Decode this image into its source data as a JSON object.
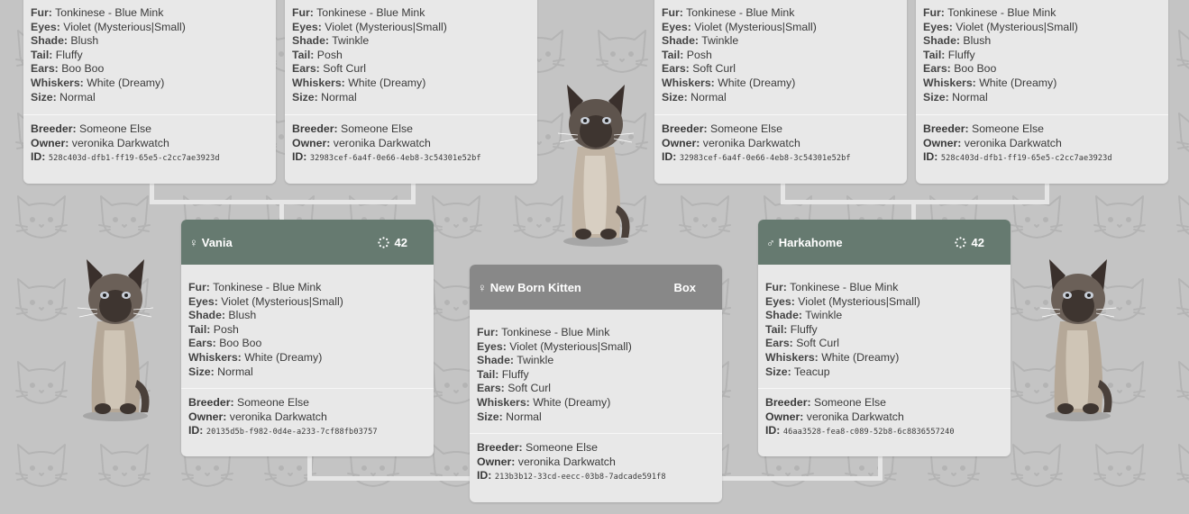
{
  "colors": {
    "female_header": "#667a70",
    "male_header": "#667a70",
    "kitten_header": "#888888",
    "background": "#c4c4c4",
    "card": "#e8e8e8"
  },
  "labels": {
    "fur": "Fur:",
    "eyes": "Eyes:",
    "shade": "Shade:",
    "tail": "Tail:",
    "ears": "Ears:",
    "whiskers": "Whiskers:",
    "size": "Size:",
    "breeder": "Breeder:",
    "owner": "Owner:",
    "id": "ID:"
  },
  "grandparents": [
    {
      "fur": "Tonkinese - Blue Mink",
      "eyes": "Violet (Mysterious|Small)",
      "shade": "Blush",
      "tail": "Fluffy",
      "ears": "Boo Boo",
      "whiskers": "White (Dreamy)",
      "size": "Normal",
      "breeder": "Someone Else",
      "owner": "veronika Darkwatch",
      "id": "528c403d-dfb1-ff19-65e5-c2cc7ae3923d"
    },
    {
      "fur": "Tonkinese - Blue Mink",
      "eyes": "Violet (Mysterious|Small)",
      "shade": "Twinkle",
      "tail": "Posh",
      "ears": "Soft Curl",
      "whiskers": "White (Dreamy)",
      "size": "Normal",
      "breeder": "Someone Else",
      "owner": "veronika Darkwatch",
      "id": "32983cef-6a4f-0e66-4eb8-3c54301e52bf"
    },
    {
      "fur": "Tonkinese - Blue Mink",
      "eyes": "Violet (Mysterious|Small)",
      "shade": "Twinkle",
      "tail": "Posh",
      "ears": "Soft Curl",
      "whiskers": "White (Dreamy)",
      "size": "Normal",
      "breeder": "Someone Else",
      "owner": "veronika Darkwatch",
      "id": "32983cef-6a4f-0e66-4eb8-3c54301e52bf"
    },
    {
      "fur": "Tonkinese - Blue Mink",
      "eyes": "Violet (Mysterious|Small)",
      "shade": "Blush",
      "tail": "Fluffy",
      "ears": "Boo Boo",
      "whiskers": "White (Dreamy)",
      "size": "Normal",
      "breeder": "Someone Else",
      "owner": "veronika Darkwatch",
      "id": "528c403d-dfb1-ff19-65e5-c2cc7ae3923d"
    }
  ],
  "mother": {
    "sex_symbol": "♀",
    "name": "Vania",
    "badge_icon": "loading-ring-icon",
    "badge_value": "42",
    "fur": "Tonkinese - Blue Mink",
    "eyes": "Violet (Mysterious|Small)",
    "shade": "Blush",
    "tail": "Posh",
    "ears": "Boo Boo",
    "whiskers": "White (Dreamy)",
    "size": "Normal",
    "breeder": "Someone Else",
    "owner": "veronika Darkwatch",
    "id": "20135d5b-f982-0d4e-a233-7cf88fb03757"
  },
  "father": {
    "sex_symbol": "♂",
    "name": "Harkahome",
    "badge_icon": "loading-ring-icon",
    "badge_value": "42",
    "fur": "Tonkinese - Blue Mink",
    "eyes": "Violet (Mysterious|Small)",
    "shade": "Twinkle",
    "tail": "Fluffy",
    "ears": "Soft Curl",
    "whiskers": "White (Dreamy)",
    "size": "Teacup",
    "breeder": "Someone Else",
    "owner": "veronika Darkwatch",
    "id": "46aa3528-fea8-c089-52b8-6c8836557240"
  },
  "kitten": {
    "sex_symbol": "♀",
    "name": "New Born Kitten",
    "action_label": "Box",
    "fur": "Tonkinese - Blue Mink",
    "eyes": "Violet (Mysterious|Small)",
    "shade": "Twinkle",
    "tail": "Fluffy",
    "ears": "Soft Curl",
    "whiskers": "White (Dreamy)",
    "size": "Normal",
    "breeder": "Someone Else",
    "owner": "veronika Darkwatch",
    "id": "213b3b12-33cd-eecc-03b8-7adcade591f8"
  }
}
